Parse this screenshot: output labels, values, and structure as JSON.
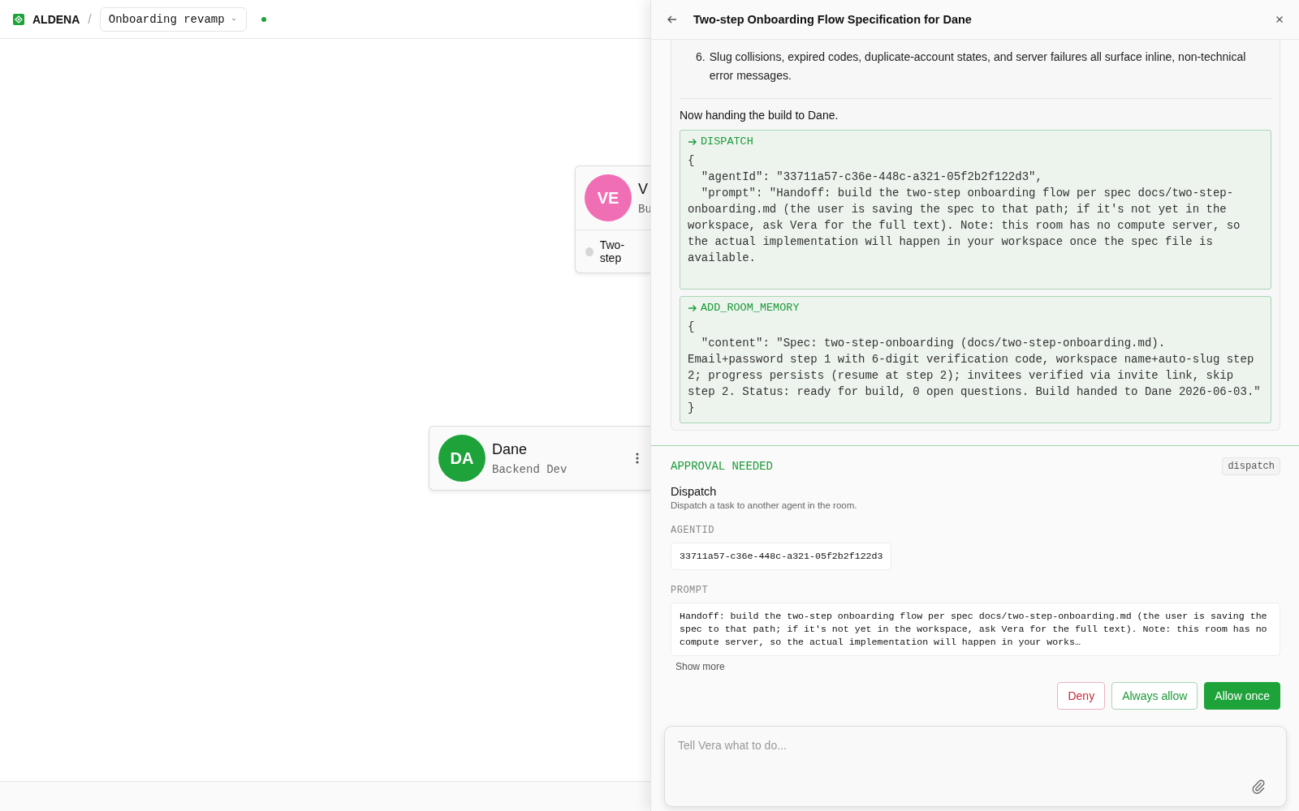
{
  "topbar": {
    "brand": "ALDENA",
    "separator": "/",
    "project": "Onboarding revamp"
  },
  "nodes": [
    {
      "initials": "VE",
      "name": "V",
      "role": "Bu",
      "task": "Two-step",
      "color": "#f06eb4",
      "kind": "task"
    },
    {
      "initials": "DA",
      "name": "Dane",
      "role": "Backend Dev",
      "color": "#1ea33a",
      "kind": "menu"
    }
  ],
  "panel": {
    "title": "Two-step Onboarding Flow Specification for Dane",
    "list_item": {
      "number": "6.",
      "text": "Slug collisions, expired codes, duplicate-account states, and server failures all surface inline, non-technical error messages."
    },
    "message": "Now handing the build to Dane.",
    "tool_calls": [
      {
        "name": "DISPATCH",
        "body": "{\n  \"agentId\": \"33711a57-c36e-448c-a321-05f2b2f122d3\",\n  \"prompt\": \"Handoff: build the two-step onboarding flow per spec docs/two-step-onboarding.md (the user is saving the spec to that path; if it's not yet in the workspace, ask Vera for the full text). Note: this room has no compute server, so the actual implementation will happen in your workspace once the spec file is available.\n"
      },
      {
        "name": "ADD_ROOM_MEMORY",
        "body": "{\n  \"content\": \"Spec: two-step-onboarding (docs/two-step-onboarding.md). Email+password step 1 with 6-digit verification code, workspace name+auto-slug step 2; progress persists (resume at step 2); invitees verified via invite link, skip step 2. Status: ready for build, 0 open questions. Build handed to Dane 2026-06-03.\"\n}"
      }
    ],
    "approval": {
      "heading": "APPROVAL NEEDED",
      "tag": "dispatch",
      "tool": "Dispatch",
      "description": "Dispatch a task to another agent in the room.",
      "fields": [
        {
          "label": "AGENTID",
          "value": "33711a57-c36e-448c-a321-05f2b2f122d3",
          "kind": "short"
        },
        {
          "label": "PROMPT",
          "value": "Handoff: build the two-step onboarding flow per spec docs/two-step-onboarding.md (the user is saving the spec to that path; if it's not yet in the workspace, ask Vera for the full text). Note: this room has no compute server, so the actual implementation will happen in your works…",
          "kind": "long"
        }
      ],
      "show_more": "Show more",
      "buttons": [
        {
          "label": "Deny",
          "kind": "danger"
        },
        {
          "label": "Always allow",
          "kind": "outline"
        },
        {
          "label": "Allow once",
          "kind": "primary"
        }
      ]
    },
    "composer": {
      "placeholder": "Tell Vera what to do..."
    }
  }
}
